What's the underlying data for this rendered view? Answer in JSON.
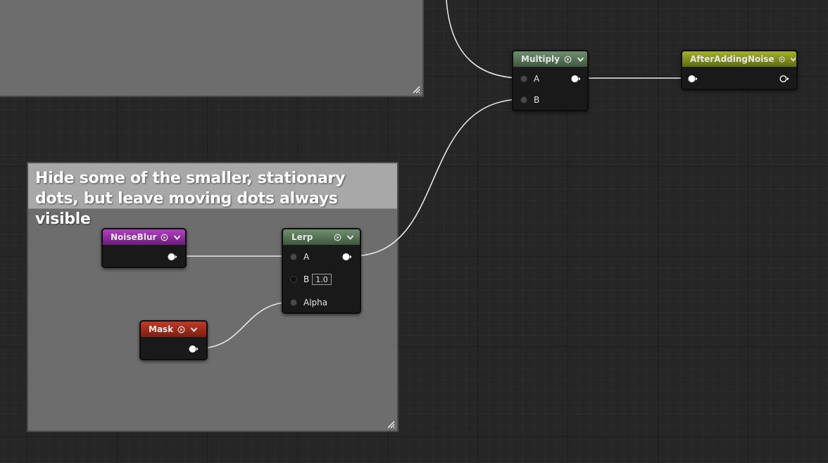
{
  "comments": [
    {
      "id": "top",
      "text": ""
    },
    {
      "id": "main",
      "text": "Hide some of the smaller, stationary dots, but leave moving dots always visible"
    }
  ],
  "nodes": {
    "multiply": {
      "title": "Multiply",
      "pins": {
        "a": "A",
        "b": "B"
      },
      "header_color": "#5c7a5c"
    },
    "after_adding_noise": {
      "title": "AfterAddingNoise",
      "header_color": "#8a9a1e"
    },
    "noise_blur": {
      "title": "NoiseBlur",
      "header_color": "#a02bb0"
    },
    "lerp": {
      "title": "Lerp",
      "pins": {
        "a": "A",
        "b": "B",
        "b_value": "1.0",
        "alpha": "Alpha"
      },
      "header_color": "#5c7a5c"
    },
    "mask": {
      "title": "Mask",
      "header_color": "#b0321f"
    }
  },
  "icons": [
    "preview-toggle-icon",
    "chevron-down-icon",
    "pin-output-arrow-icon",
    "resize-grip-icon"
  ],
  "colors": {
    "canvas": "#262626",
    "grid_minor": "#2b2b2b",
    "grid_major": "#1e1e1e",
    "comment_body": "#6d6d6d",
    "comment_header": "#a8a8a8",
    "wire": "#e8e8e8"
  }
}
